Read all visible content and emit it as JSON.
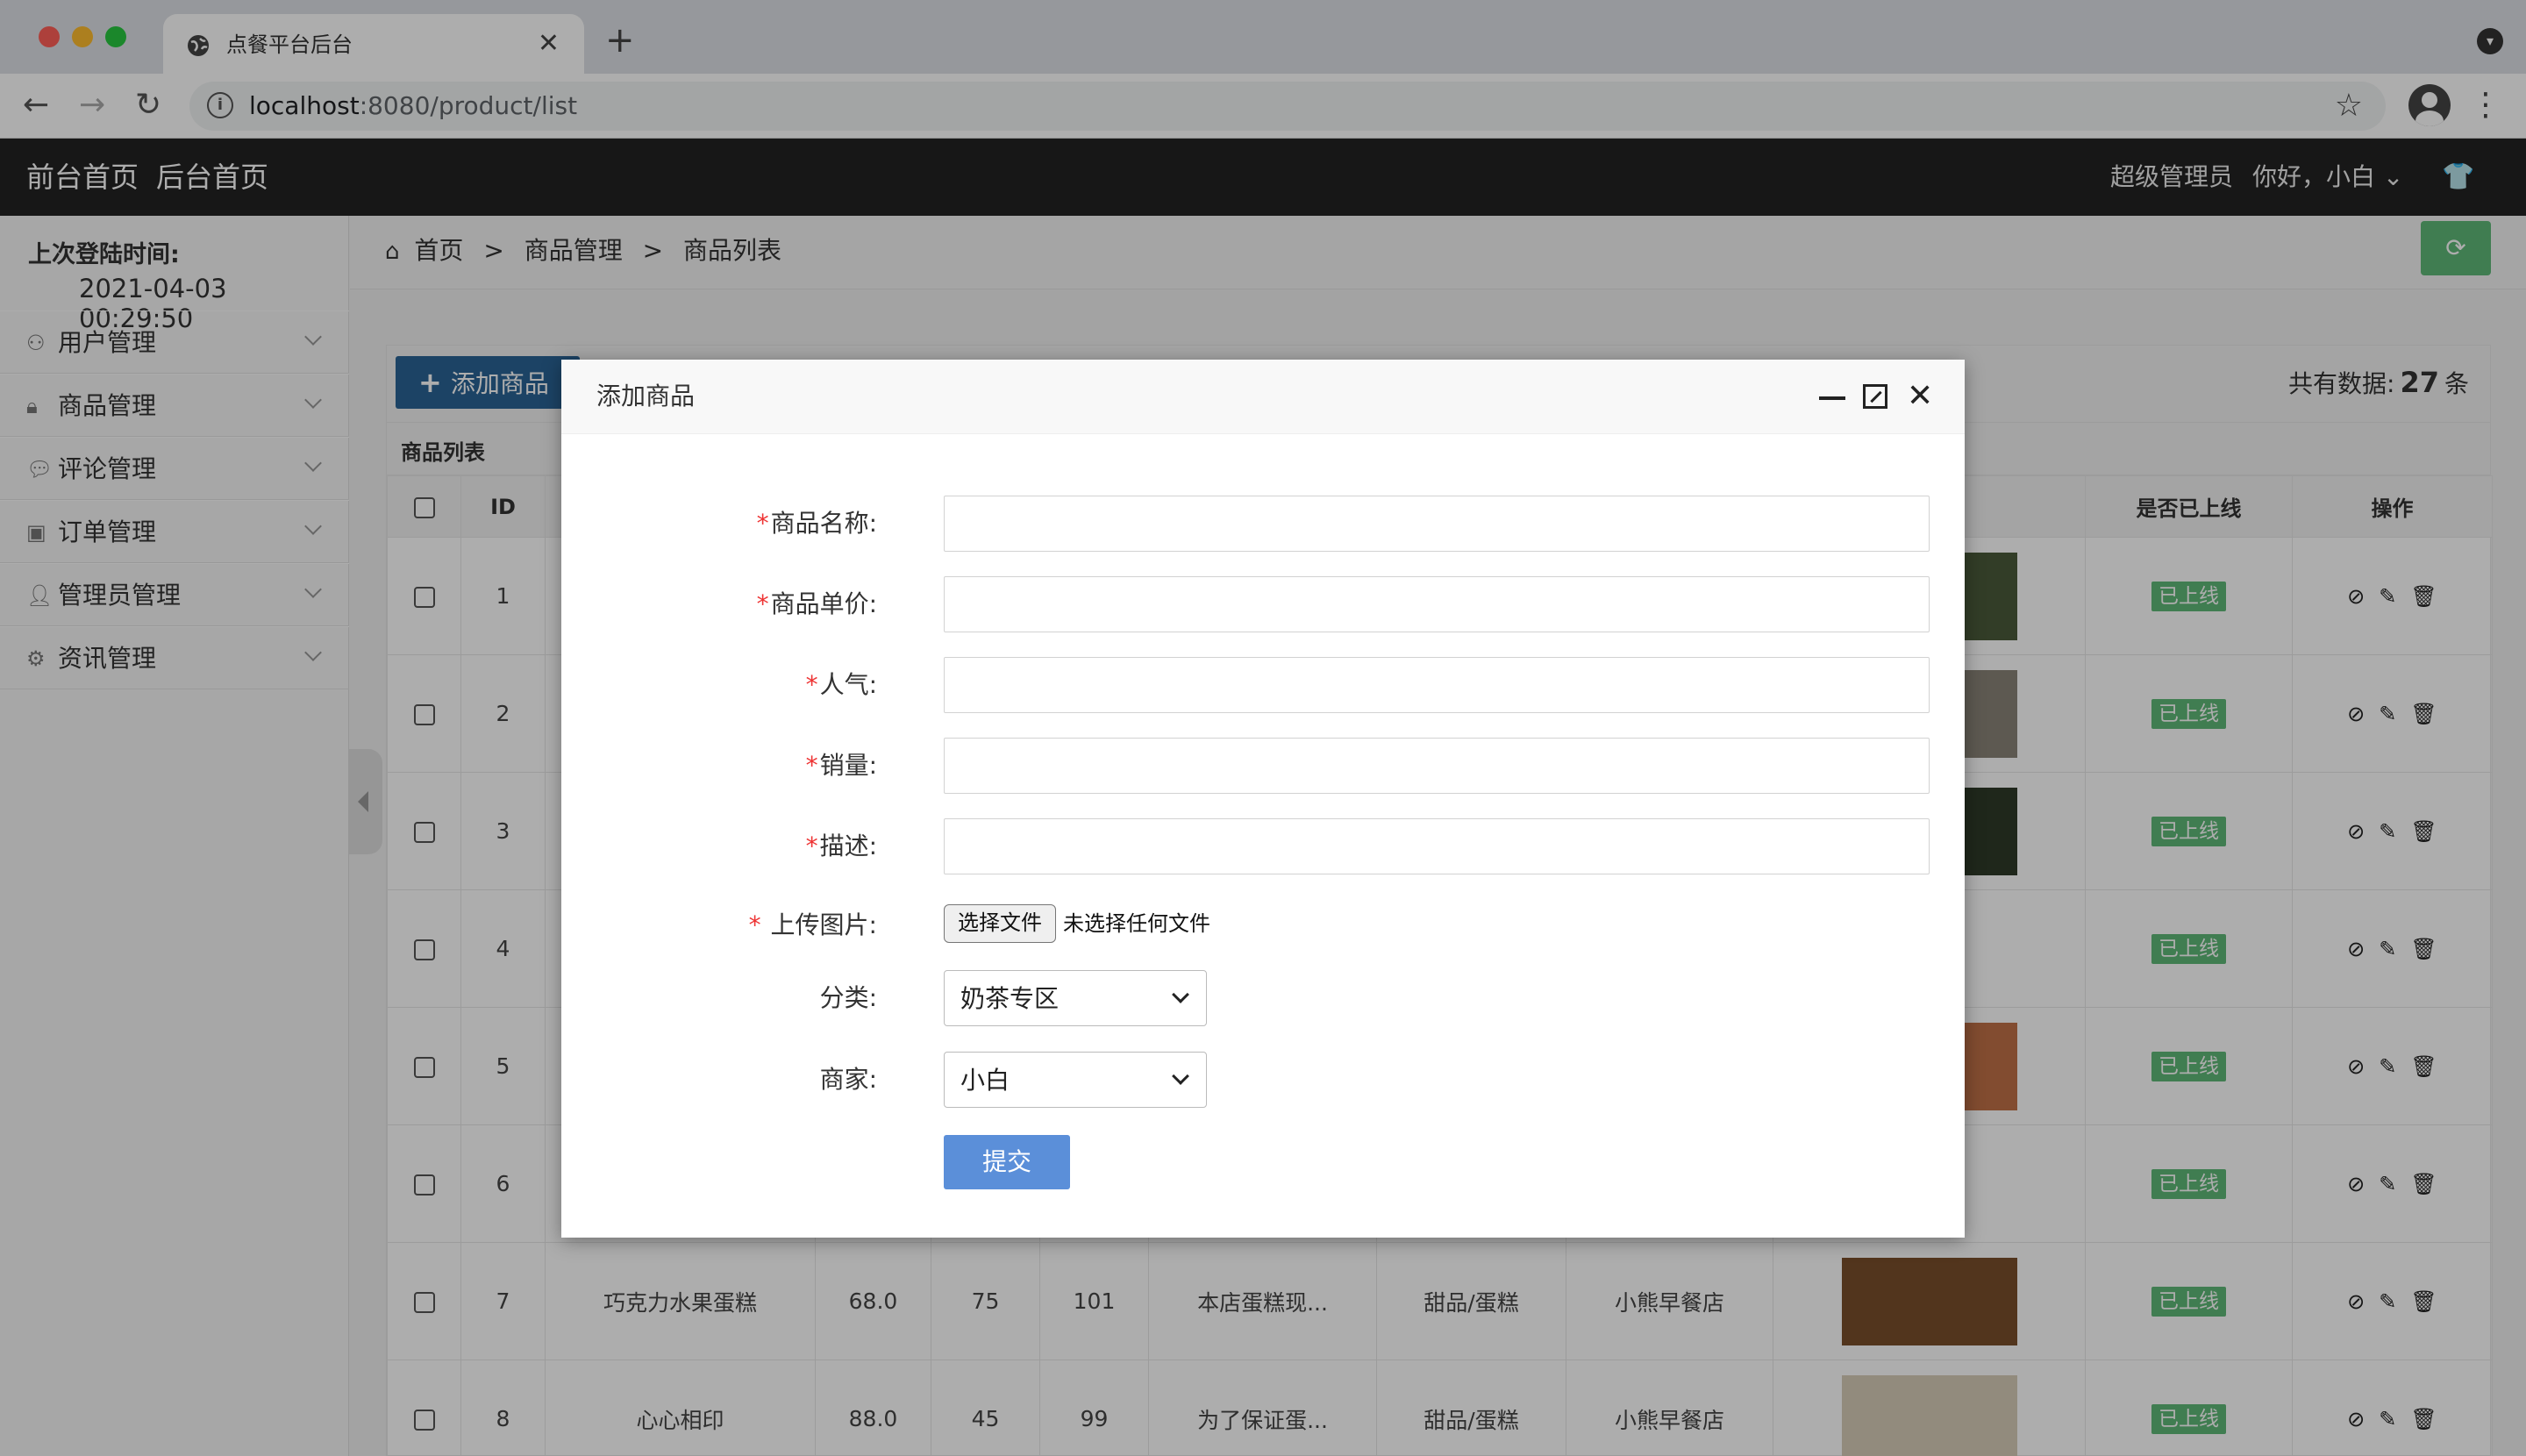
{
  "browser": {
    "tab_title": "点餐平台后台",
    "url_host": "localhost",
    "url_path": ":8080/product/list",
    "traffic_colors": [
      "#ff5f57",
      "#febc2e",
      "#28c840"
    ]
  },
  "topbar": {
    "front_home": "前台首页",
    "back_home": "后台首页",
    "role": "超级管理员",
    "greeting": "你好，小白"
  },
  "sidebar": {
    "login_label": "上次登陆时间:",
    "login_time": "2021-04-03 00:29:50",
    "items": [
      {
        "label": "用户管理",
        "icon": "user-icon"
      },
      {
        "label": "商品管理",
        "icon": "lock-icon"
      },
      {
        "label": "评论管理",
        "icon": "comment-icon"
      },
      {
        "label": "订单管理",
        "icon": "image-icon"
      },
      {
        "label": "管理员管理",
        "icon": "admin-icon"
      },
      {
        "label": "资讯管理",
        "icon": "gear-icon"
      }
    ]
  },
  "breadcrumb": {
    "home": "首页",
    "sep1": ">",
    "level1": "商品管理",
    "sep2": ">",
    "level2": "商品列表"
  },
  "panel": {
    "add_button": "添加商品",
    "total_prefix": "共有数据:",
    "total_count": "27",
    "total_suffix": "条",
    "list_title": "商品列表"
  },
  "table": {
    "headers": {
      "id": "ID",
      "online": "是否已上线",
      "ops": "操作"
    },
    "rows": [
      {
        "id": "1",
        "name": "",
        "price": "",
        "pop": "",
        "sales": "",
        "desc": "",
        "cat": "",
        "shop": "",
        "img": "#4a5a3a",
        "status": "已上线"
      },
      {
        "id": "2",
        "name": "",
        "price": "",
        "pop": "",
        "sales": "",
        "desc": "",
        "cat": "",
        "shop": "",
        "img": "#8a8478",
        "status": "已上线"
      },
      {
        "id": "3",
        "name": "",
        "price": "",
        "pop": "",
        "sales": "",
        "desc": "",
        "cat": "",
        "shop": "",
        "img": "#2e3a28",
        "status": "已上线"
      },
      {
        "id": "4",
        "name": "",
        "price": "",
        "pop": "",
        "sales": "",
        "desc": "",
        "cat": "",
        "shop": "",
        "img": "#ffffff",
        "status": "已上线"
      },
      {
        "id": "5",
        "name": "",
        "price": "",
        "pop": "",
        "sales": "",
        "desc": "",
        "cat": "",
        "shop": "",
        "img": "#c07048",
        "status": "已上线"
      },
      {
        "id": "6",
        "name": "",
        "price": "",
        "pop": "",
        "sales": "",
        "desc": "",
        "cat": "",
        "shop": "",
        "img": "#ffffff",
        "status": "已上线"
      },
      {
        "id": "7",
        "name": "巧克力水果蛋糕",
        "price": "68.0",
        "pop": "75",
        "sales": "101",
        "desc": "本店蛋糕现...",
        "cat": "甜品/蛋糕",
        "shop": "小熊早餐店",
        "img": "#7a4e2c",
        "status": "已上线"
      },
      {
        "id": "8",
        "name": "心心相印",
        "price": "88.0",
        "pop": "45",
        "sales": "99",
        "desc": "为了保证蛋...",
        "cat": "甜品/蛋糕",
        "shop": "小熊早餐店",
        "img": "#d8cdb8",
        "status": "已上线"
      }
    ]
  },
  "modal": {
    "title": "添加商品",
    "fields": [
      {
        "label": "商品名称:",
        "required": "*",
        "value": ""
      },
      {
        "label": "商品单价:",
        "required": "*",
        "value": ""
      },
      {
        "label": "人气:",
        "required": "*",
        "value": ""
      },
      {
        "label": "销量:",
        "required": "*",
        "value": ""
      },
      {
        "label": "描述:",
        "required": "*",
        "value": ""
      }
    ],
    "upload": {
      "label": " 上传图片:",
      "required": "*",
      "button": "选择文件",
      "status": "未选择任何文件"
    },
    "category": {
      "label": "分类:",
      "value": "奶茶专区"
    },
    "merchant": {
      "label": "商家:",
      "value": "小白"
    },
    "submit": "提交"
  }
}
